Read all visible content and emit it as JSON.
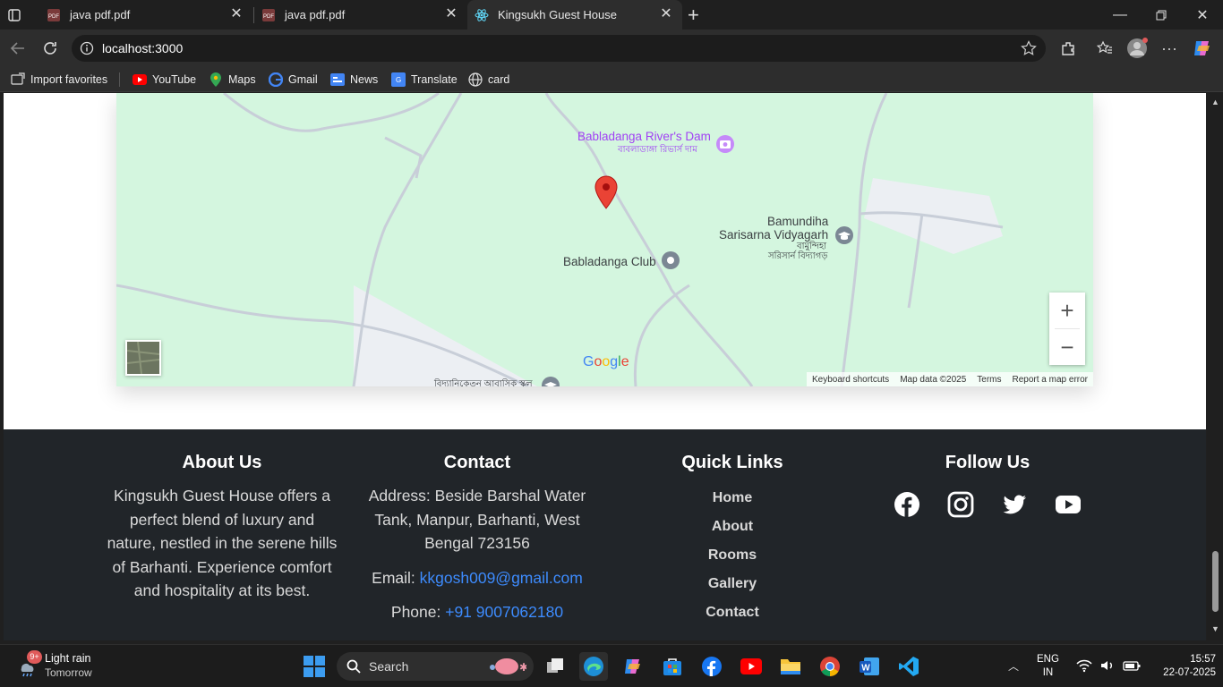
{
  "tabs": [
    {
      "title": "java pdf.pdf",
      "icon": "pdf-icon"
    },
    {
      "title": "java pdf.pdf",
      "icon": "pdf-icon"
    },
    {
      "title": "Kingsukh Guest House",
      "icon": "react-icon"
    }
  ],
  "address": {
    "url": "localhost:3000"
  },
  "bookmarks": [
    "Import favorites",
    "YouTube",
    "Maps",
    "Gmail",
    "News",
    "Translate",
    "card"
  ],
  "map": {
    "labels": {
      "dam": "Babladanga River's Dam",
      "dam_bn": "বাবলাডাঙ্গা রিভার্স দাম",
      "school1": "Bamundiha",
      "school2": "Sarisarna Vidyagarh",
      "school_bn1": "বামুন্দিহা",
      "school_bn2": "সরিসার্ন বিদ্যাগড়",
      "club": "Babladanga Club",
      "bottom_bn": "বিদ্যানিকেতন আবাসিক স্কুল"
    },
    "google": "Google",
    "attribution": [
      "Keyboard shortcuts",
      "Map data ©2025",
      "Terms",
      "Report a map error"
    ],
    "zoom_in": "+",
    "zoom_out": "−"
  },
  "footer": {
    "about": {
      "title": "About Us",
      "text": "Kingsukh Guest House offers a perfect blend of luxury and nature, nestled in the serene hills of Barhanti. Experience comfort and hospitality at its best."
    },
    "contact": {
      "title": "Contact",
      "address": "Address: Beside Barshal Water Tank, Manpur, Barhanti, West Bengal 723156",
      "email_label": "Email: ",
      "email": "kkgosh009@gmail.com",
      "phone_label": "Phone: ",
      "phone": "+91 9007062180"
    },
    "links": {
      "title": "Quick Links",
      "items": [
        "Home",
        "About",
        "Rooms",
        "Gallery",
        "Contact"
      ]
    },
    "follow": {
      "title": "Follow Us",
      "icons": [
        "facebook-icon",
        "instagram-icon",
        "twitter-icon",
        "youtube-icon"
      ]
    }
  },
  "taskbar": {
    "weather": {
      "title": "Light rain",
      "sub": "Tomorrow",
      "badge": "9+"
    },
    "search": "Search",
    "lang1": "ENG",
    "lang2": "IN",
    "time": "15:57",
    "date": "22-07-2025"
  }
}
